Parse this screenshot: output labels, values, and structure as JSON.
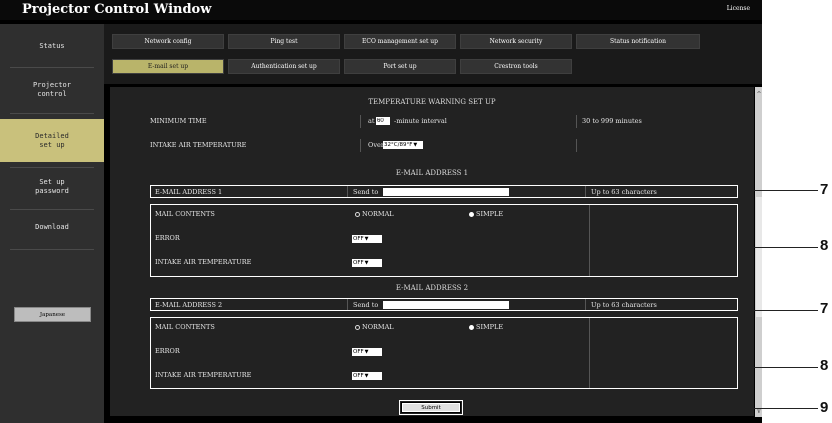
{
  "app": {
    "title": "Projector Control Window",
    "license": "License"
  },
  "sidebar": {
    "items": [
      {
        "label": "Status"
      },
      {
        "label": "Projector\ncontrol"
      },
      {
        "label": "Detailed\nset up"
      },
      {
        "label": "Set up\npassword"
      },
      {
        "label": "Download"
      }
    ],
    "language": "Japanese"
  },
  "tabs": {
    "row1": [
      "Network config",
      "Ping test",
      "ECO management set up",
      "Network security",
      "Status notification"
    ],
    "row2": [
      "E-mail set up",
      "Authentication set up",
      "Port set up",
      "Crestron tools"
    ]
  },
  "temperature_warning": {
    "title": "TEMPERATURE WARNING SET UP",
    "min_time_label": "MINIMUM TIME",
    "at": "at",
    "min_time_value": "60",
    "interval": "-minute interval",
    "range": "30 to 999 minutes",
    "intake_label": "INTAKE AIR TEMPERATURE",
    "over": "Over",
    "intake_value": "32°C/89°F"
  },
  "email1": {
    "title": "E-MAIL ADDRESS 1",
    "address_label": "E-MAIL ADDRESS 1",
    "send_to": "Send to",
    "address_value": "",
    "limit": "Up to 63 characters",
    "mail_contents_label": "MAIL CONTENTS",
    "normal": "NORMAL",
    "simple": "SIMPLE",
    "error_label": "ERROR",
    "error_value": "OFF",
    "intake_label": "INTAKE AIR TEMPERATURE",
    "intake_value": "OFF"
  },
  "email2": {
    "title": "E-MAIL ADDRESS 2",
    "address_label": "E-MAIL ADDRESS 2",
    "send_to": "Send to",
    "address_value": "",
    "limit": "Up to 63 characters",
    "mail_contents_label": "MAIL CONTENTS",
    "normal": "NORMAL",
    "simple": "SIMPLE",
    "error_label": "ERROR",
    "error_value": "OFF",
    "intake_label": "INTAKE AIR TEMPERATURE",
    "intake_value": "OFF"
  },
  "submit": "Submit",
  "callouts": [
    "7",
    "8",
    "7",
    "8",
    "9"
  ]
}
